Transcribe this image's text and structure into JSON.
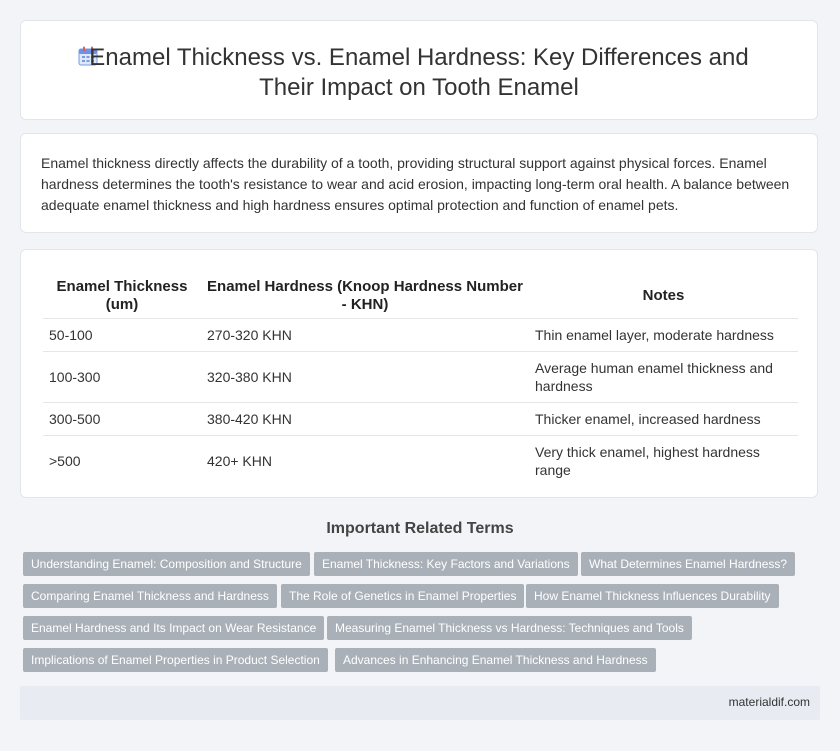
{
  "header": {
    "title": "Enamel Thickness vs. Enamel Hardness: Key Differences and Their Impact on Tooth Enamel",
    "icon": "calendar-icon"
  },
  "intro": {
    "text": "Enamel thickness directly affects the durability of a tooth, providing structural support against physical forces. Enamel hardness determines the tooth's resistance to wear and acid erosion, impacting long-term oral health. A balance between adequate enamel thickness and high hardness ensures optimal protection and function of enamel pets."
  },
  "table": {
    "headers": [
      "Enamel Thickness (um)",
      "Enamel Hardness (Knoop Hardness Number - KHN)",
      "Notes"
    ],
    "rows": [
      [
        "50-100",
        "270-320 KHN",
        "Thin enamel layer, moderate hardness"
      ],
      [
        "100-300",
        "320-380 KHN",
        "Average human enamel thickness and hardness"
      ],
      [
        "300-500",
        "380-420 KHN",
        "Thicker enamel, increased hardness"
      ],
      [
        ">500",
        "420+ KHN",
        "Very thick enamel, highest hardness range"
      ]
    ]
  },
  "related": {
    "title": "Important Related Terms",
    "tags": [
      "Understanding Enamel: Composition and Structure",
      "Enamel Thickness: Key Factors and Variations",
      "What Determines Enamel Hardness?",
      "Comparing Enamel Thickness and Hardness",
      "The Role of Genetics in Enamel Properties",
      "How Enamel Thickness Influences Durability",
      "Enamel Hardness and Its Impact on Wear Resistance",
      "Measuring Enamel Thickness vs Hardness: Techniques and Tools",
      "Implications of Enamel Properties in Product Selection",
      "Advances in Enhancing Enamel Thickness and Hardness"
    ]
  },
  "footer": {
    "site": "materialdif.com"
  },
  "colors": {
    "accent": "#4a7fd6",
    "tag_bg": "#aab0b8"
  }
}
